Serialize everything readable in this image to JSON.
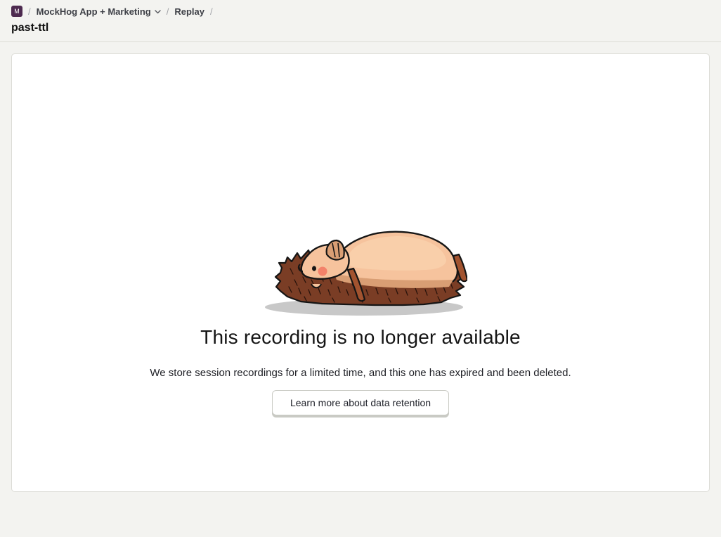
{
  "breadcrumbs": {
    "project_initial": "M",
    "separator": "/",
    "project_name": "MockHog App + Marketing",
    "section": "Replay"
  },
  "page": {
    "title": "past-ttl"
  },
  "empty_state": {
    "illustration": "sleeping-hedgehog",
    "title": "This recording is no longer available",
    "description": "We store session recordings for a limited time, and this one has expired and been deleted.",
    "button_label": "Learn more about data retention"
  },
  "colors": {
    "page_background": "#f3f3f0",
    "panel_background": "#ffffff",
    "project_badge": "#4d2a4f"
  }
}
